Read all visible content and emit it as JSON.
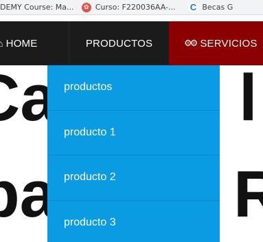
{
  "bookmarks": [
    {
      "label": "UDEMY Course: Ma..."
    },
    {
      "label": "Curso: F220036AA-..."
    },
    {
      "label": "Becas G"
    }
  ],
  "nav": {
    "home": "HOME",
    "productos": "PRODUCTOS",
    "servicios": "SERVICIOS"
  },
  "hero": {
    "line1_left": "Ca",
    "line1_right": "l",
    "line2_left": "pa",
    "line2_right": "R"
  },
  "dropdown": {
    "items": [
      "productos",
      "producto 1",
      "producto 2",
      "producto 3"
    ]
  },
  "colors": {
    "navbar": "#1b1b1b",
    "servicios": "#8b0000",
    "dropdown": "#0a9be2"
  }
}
